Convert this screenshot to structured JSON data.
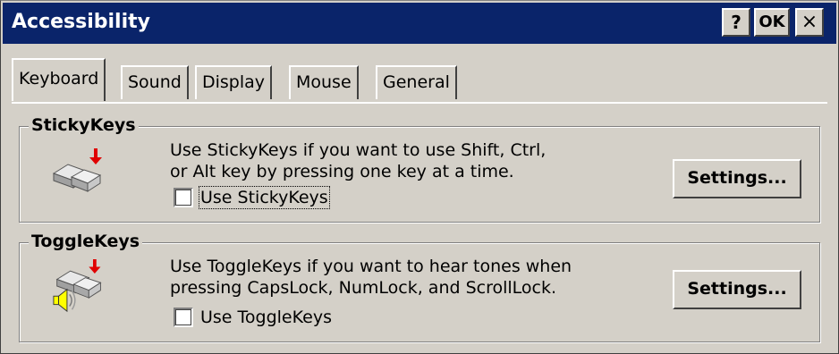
{
  "window": {
    "title": "Accessibility",
    "help_label": "?",
    "ok_label": "OK",
    "close_label": "×"
  },
  "tabs": [
    {
      "label": "Keyboard",
      "active": true
    },
    {
      "label": "Sound",
      "active": false
    },
    {
      "label": "Display",
      "active": false
    },
    {
      "label": "Mouse",
      "active": false
    },
    {
      "label": "General",
      "active": false
    }
  ],
  "sticky_keys": {
    "title": "StickyKeys",
    "description_line1": "Use StickyKeys if you want to use Shift, Ctrl,",
    "description_line2": "or Alt key by pressing one key at a time.",
    "checkbox_label": "Use StickyKeys",
    "checked": false,
    "settings_label": "Settings...",
    "icon": "keyboard-keys-icon"
  },
  "toggle_keys": {
    "title": "ToggleKeys",
    "description_line1": "Use ToggleKeys if you want to hear tones when",
    "description_line2": "pressing CapsLock, NumLock, and ScrollLock.",
    "checkbox_label": "Use ToggleKeys",
    "checked": false,
    "settings_label": "Settings...",
    "icon": "keyboard-keys-speaker-icon"
  },
  "colors": {
    "titlebar": "#0a246a",
    "face": "#d4d0c8",
    "arrow": "#e00000"
  }
}
